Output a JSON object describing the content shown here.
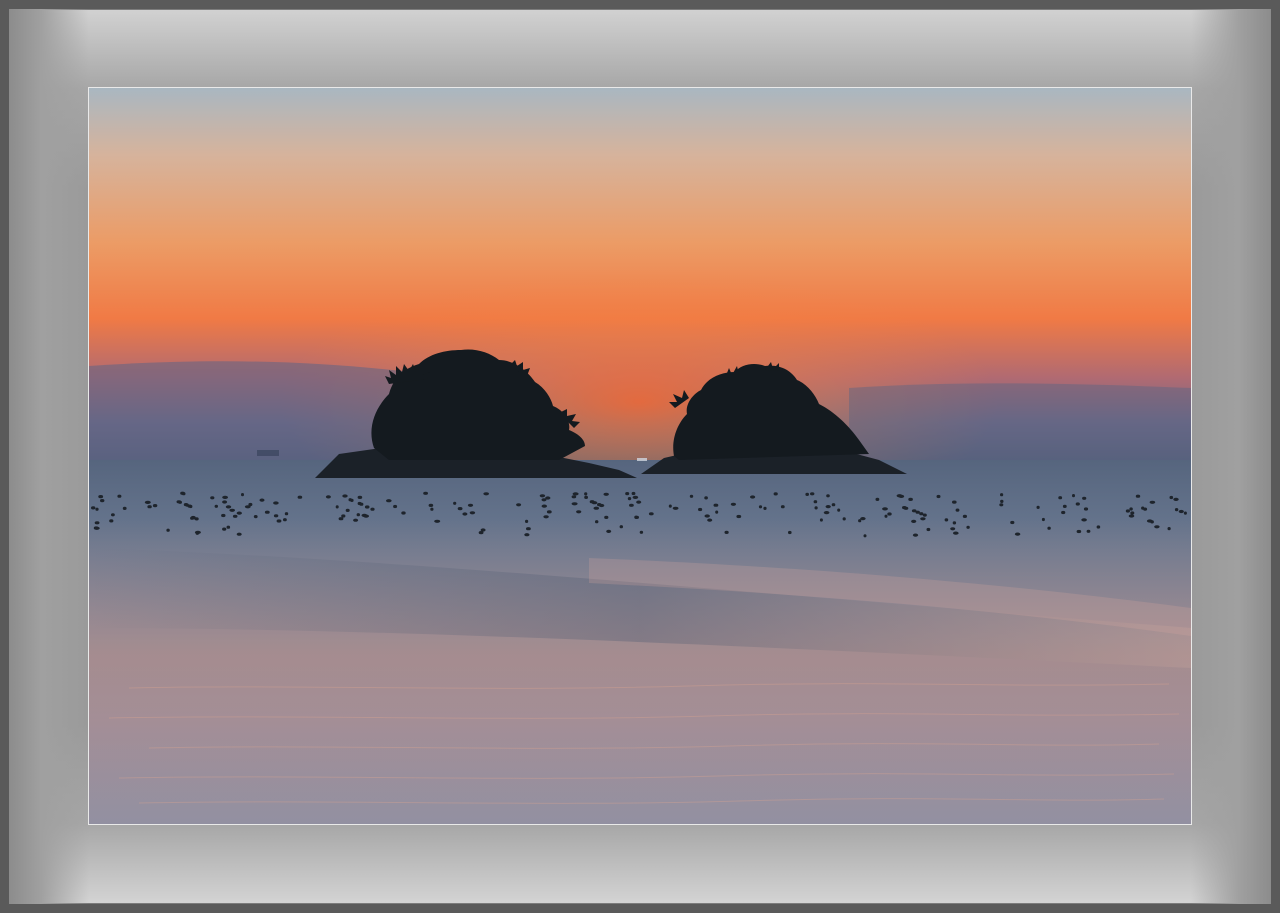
{
  "image": {
    "subject": "sunset-seascape",
    "frame": {
      "mat_color": "#9a9a9a",
      "border_color": "#e9e9e9"
    },
    "colors": {
      "sky_top": "#9fb4c2",
      "sky_glow": "#f18a45",
      "sky_horizon": "#6f6a86",
      "sea_top": "#5e6f86",
      "sea_reflection": "#c48a7e",
      "island_silhouette": "#141b22"
    }
  }
}
